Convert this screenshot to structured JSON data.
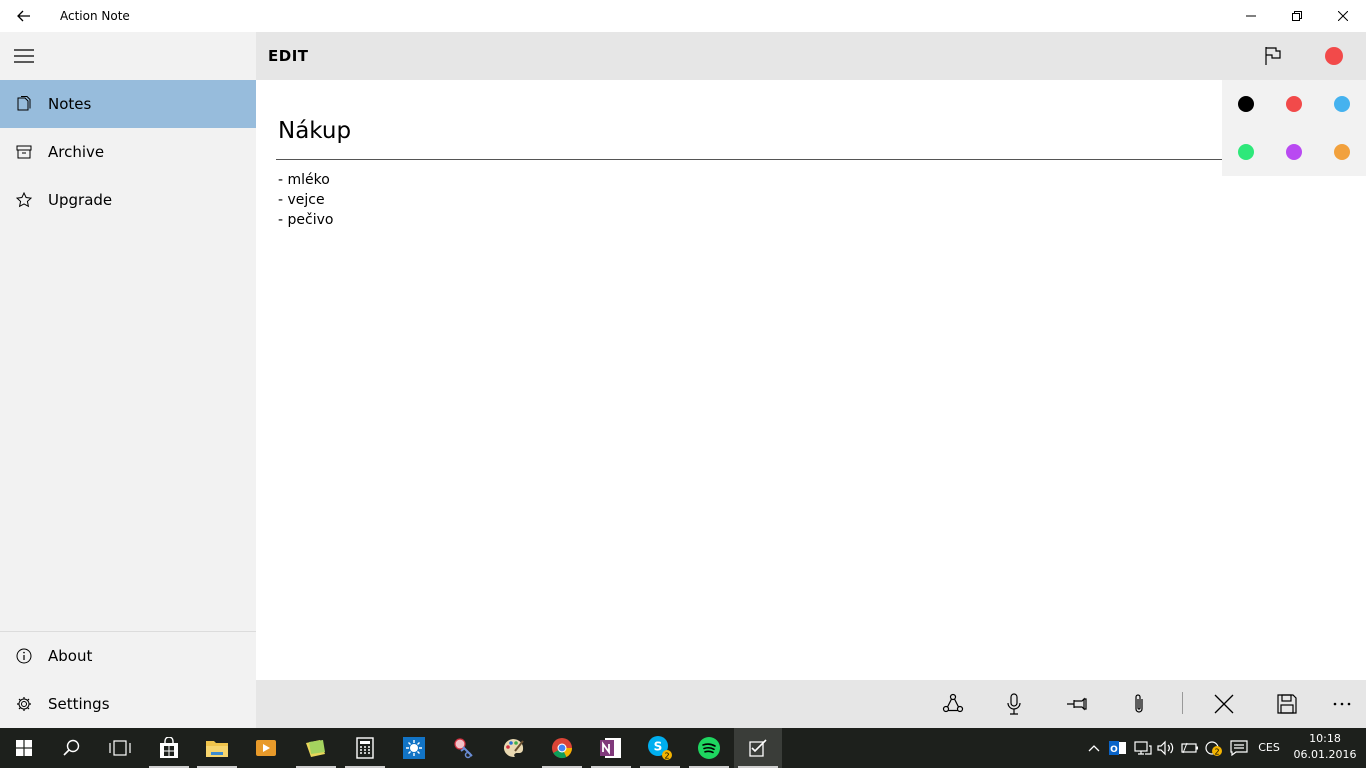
{
  "window": {
    "title": "Action Note"
  },
  "sidebar": {
    "items": [
      {
        "label": "Notes",
        "icon": "notes-icon"
      },
      {
        "label": "Archive",
        "icon": "archive-icon"
      },
      {
        "label": "Upgrade",
        "icon": "star-icon"
      }
    ],
    "footer_items": [
      {
        "label": "About",
        "icon": "info-icon"
      },
      {
        "label": "Settings",
        "icon": "gear-icon"
      }
    ],
    "active_color": "#97bcdc"
  },
  "header": {
    "title": "EDIT",
    "selected_color": "#f24a4a"
  },
  "note": {
    "title": "Nákup",
    "body_lines": [
      "- mléko",
      "- vejce",
      "- pečivo"
    ]
  },
  "color_picker": {
    "colors": [
      "#000000",
      "#f24a4a",
      "#45b2ef",
      "#2ee87a",
      "#b94af2",
      "#f2a13d"
    ]
  },
  "command_bar": {
    "icons": [
      "share-icon",
      "microphone-icon",
      "pin-icon",
      "attach-icon",
      "close-icon",
      "save-icon",
      "more-icon"
    ]
  },
  "taskbar": {
    "language": "CES",
    "time": "10:18",
    "date": "06.01.2016",
    "skype_badge": "2",
    "tray_badge": "2"
  }
}
